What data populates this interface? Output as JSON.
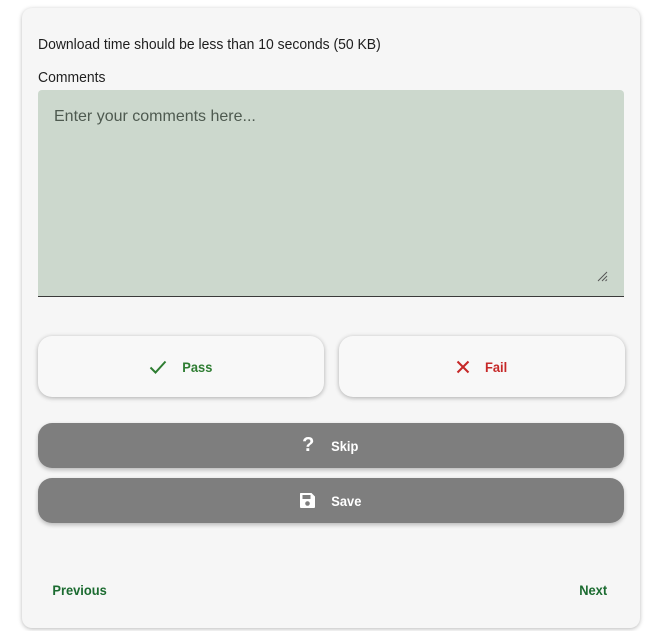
{
  "test": {
    "requirement": "Download time should be less than 10 seconds (50 KB)"
  },
  "comments": {
    "label": "Comments",
    "placeholder": "Enter your comments here...",
    "value": ""
  },
  "actions": {
    "pass_label": "Pass",
    "fail_label": "Fail",
    "skip_label": "Skip",
    "save_label": "Save"
  },
  "navigation": {
    "previous_label": "Previous",
    "next_label": "Next"
  },
  "icons": {
    "pass": "check-icon",
    "fail": "close-icon",
    "skip": "question-mark-icon",
    "save": "floppy-disk-icon"
  },
  "colors": {
    "pass": "#2e7d32",
    "fail": "#c62828",
    "secondary_button": "#7e7e7e",
    "textarea_background": "#ccd8cd",
    "nav_link": "#1b6b30"
  }
}
